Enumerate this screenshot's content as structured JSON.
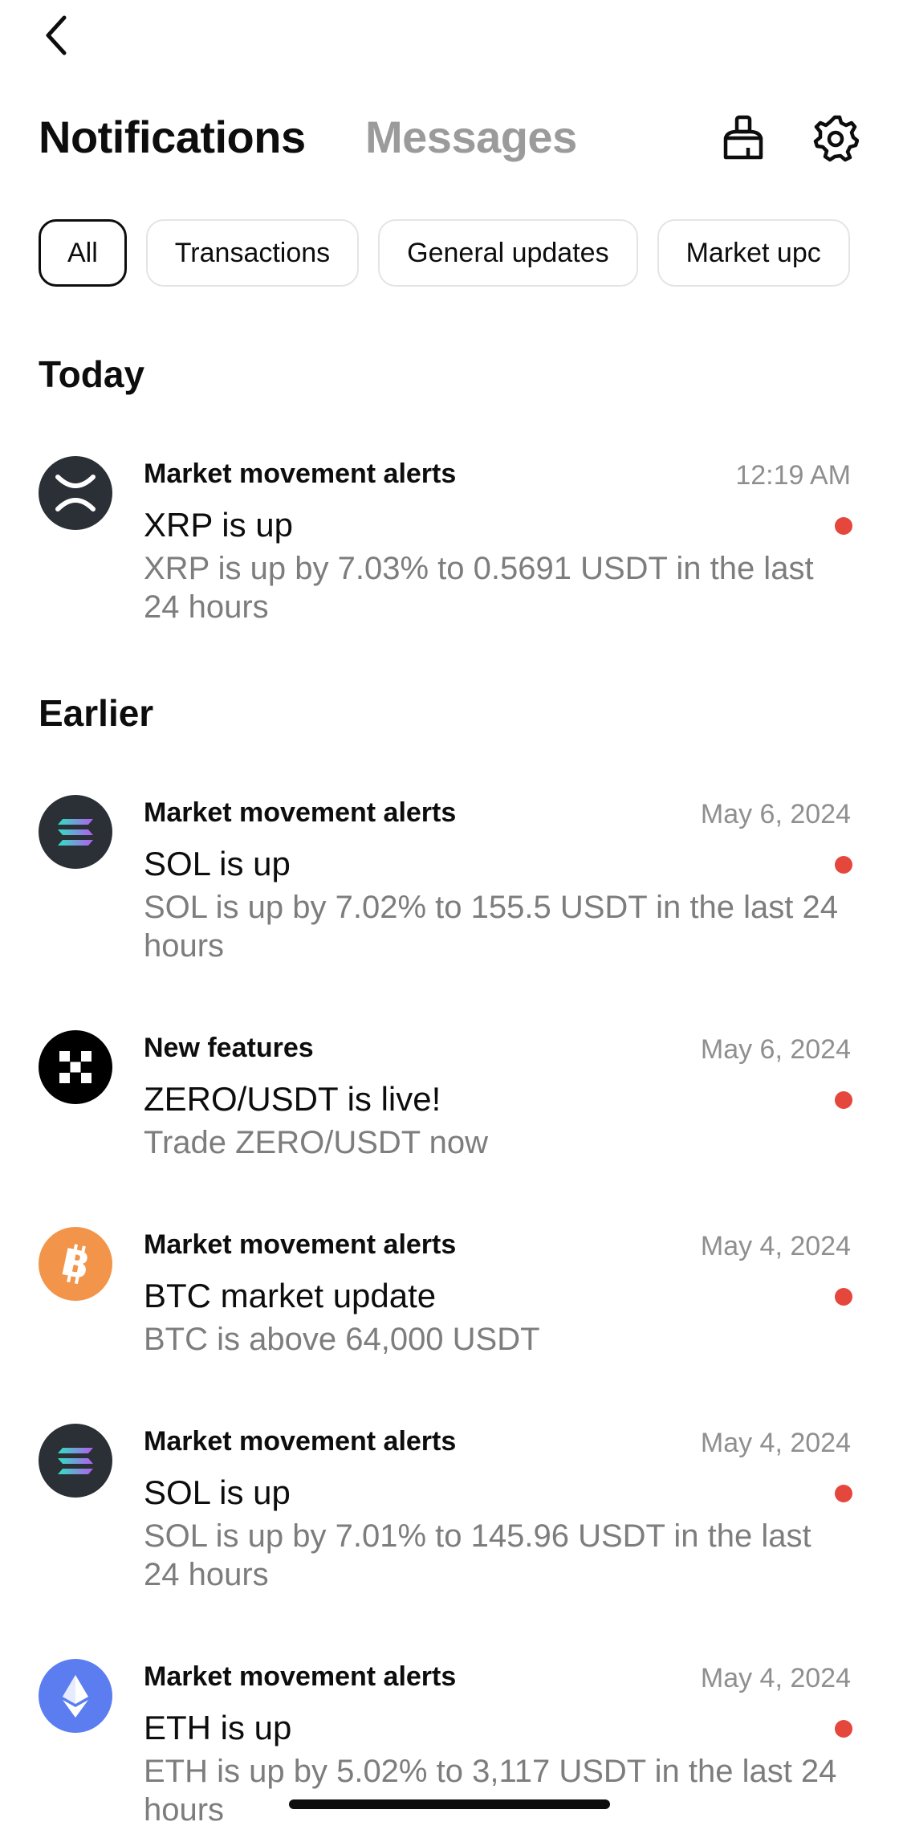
{
  "header": {
    "back_icon": "chevron-left-icon",
    "tabs": [
      "Notifications",
      "Messages"
    ],
    "clear_icon": "broom-icon",
    "settings_icon": "gear-icon"
  },
  "filters": [
    "All",
    "Transactions",
    "General updates",
    "Market upc"
  ],
  "sections": {
    "today": "Today",
    "earlier": "Earlier"
  },
  "colors": {
    "unread_dot": "#e5473d",
    "btc": "#f2954a",
    "eth": "#5b7df0",
    "dark_coin": "#2b2f36"
  },
  "notifications": [
    {
      "icon": "xrp-icon",
      "category": "Market movement alerts",
      "time": "12:19 AM",
      "title": "XRP is up",
      "body": "XRP is up by 7.03% to 0.5691 USDT in the last 24 hours",
      "unread": true
    },
    {
      "icon": "sol-icon",
      "category": "Market movement alerts",
      "time": "May 6, 2024",
      "title": "SOL is up",
      "body": "SOL is up by 7.02% to 155.5 USDT in the last 24 hours",
      "unread": true
    },
    {
      "icon": "okx-icon",
      "category": "New features",
      "time": "May 6, 2024",
      "title": "ZERO/USDT is live!",
      "body": "Trade ZERO/USDT now",
      "unread": true
    },
    {
      "icon": "btc-icon",
      "category": "Market movement alerts",
      "time": "May 4, 2024",
      "title": "BTC market update",
      "body": "BTC is above 64,000 USDT",
      "unread": true
    },
    {
      "icon": "sol-icon",
      "category": "Market movement alerts",
      "time": "May 4, 2024",
      "title": "SOL is up",
      "body": "SOL is up by 7.01% to 145.96 USDT in the last 24 hours",
      "unread": true
    },
    {
      "icon": "eth-icon",
      "category": "Market movement alerts",
      "time": "May 4, 2024",
      "title": "ETH is up",
      "body": "ETH is up by 5.02% to 3,117 USDT in the last 24 hours",
      "unread": true
    }
  ]
}
